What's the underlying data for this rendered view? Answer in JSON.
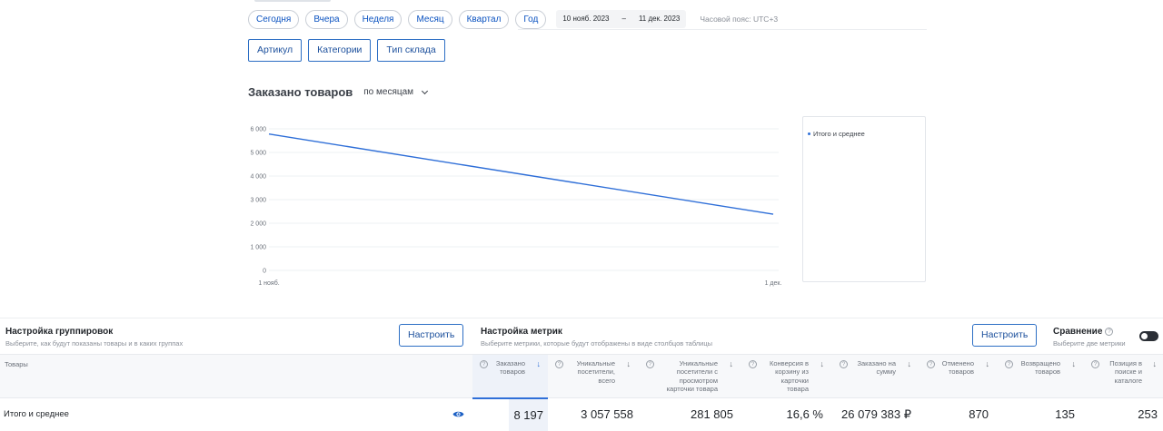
{
  "filters": {
    "periods": [
      "Сегодня",
      "Вчера",
      "Неделя",
      "Месяц",
      "Квартал",
      "Год"
    ],
    "date_from": "10 нояб. 2023",
    "date_sep": "–",
    "date_to": "11 дек. 2023",
    "timezone": "Часовой пояс: UTC+3"
  },
  "groupings": [
    "Артикул",
    "Категории",
    "Тип склада"
  ],
  "chart_header": {
    "title": "Заказано товаров",
    "period_select": "по месяцам"
  },
  "chart_data": {
    "type": "line",
    "x": [
      "1 нояб.",
      "1 дек."
    ],
    "series": [
      {
        "name": "Итого и среднее",
        "values": [
          5780,
          2380
        ],
        "color": "#2f6fd8"
      }
    ],
    "yticks": [
      0,
      1000,
      2000,
      3000,
      4000,
      5000,
      6000
    ],
    "ytick_labels": [
      "0",
      "1 000",
      "2 000",
      "3 000",
      "4 000",
      "5 000",
      "6 000"
    ],
    "ylim": [
      0,
      6000
    ],
    "grid": true,
    "legend_position": "right"
  },
  "settings": {
    "grouping_title": "Настройка группировок",
    "grouping_sub": "Выберите, как будут показаны товары и в каких группах",
    "grouping_button": "Настроить",
    "metrics_title": "Настройка метрик",
    "metrics_sub": "Выберите метрики, которые будут отображены в виде столбцов таблицы",
    "metrics_button": "Настроить",
    "compare_title": "Сравнение",
    "compare_sub": "Выберите две метрики"
  },
  "table": {
    "goods_header": "Товары",
    "columns": [
      {
        "label": "Заказано\nтоваров",
        "value": "8 197"
      },
      {
        "label": "Уникальные\nпосетители,\nвсего",
        "value": "3 057 558"
      },
      {
        "label": "Уникальные\nпосетители с\nпросмотром\nкарточки товара",
        "value": "281 805"
      },
      {
        "label": "Конверсия в\nкорзину из\nкарточки\nтовара",
        "value": "16,6 %"
      },
      {
        "label": "Заказано на\nсумму",
        "value": "26 079 383 ₽"
      },
      {
        "label": "Отменено\nтоваров",
        "value": "870"
      },
      {
        "label": "Возвращено\nтоваров",
        "value": "135"
      },
      {
        "label": "Позиция в\nпоиске и\nкаталоге",
        "value": "253"
      }
    ],
    "row_name": "Итого и среднее"
  },
  "colors": {
    "accent": "#2f6fd8",
    "button_text": "#1b4f9c"
  },
  "icons": {
    "row_action": "eye-icon",
    "help": "question-circle-icon",
    "sort": "arrow-down-icon"
  }
}
